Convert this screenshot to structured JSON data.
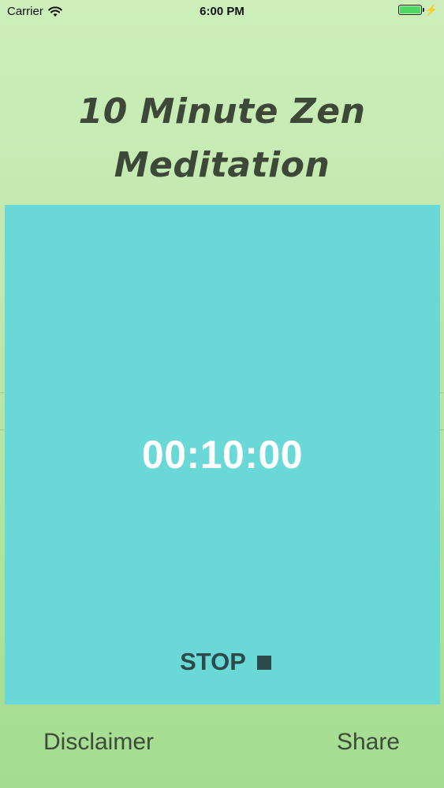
{
  "status_bar": {
    "carrier": "Carrier",
    "time": "6:00 PM",
    "battery_icon": "battery-full-icon",
    "charging_icon": "charging-bolt-icon",
    "wifi_icon": "wifi-icon",
    "battery_color": "#4cd964"
  },
  "header": {
    "title_line1": "10 Minute Zen",
    "title_line2": "Meditation"
  },
  "timer": {
    "display": "00:10:00",
    "panel_color": "#6ad8d6",
    "stop_label": "STOP",
    "stop_icon": "stop-square-icon"
  },
  "footer": {
    "disclaimer_label": "Disclaimer",
    "share_label": "Share"
  }
}
